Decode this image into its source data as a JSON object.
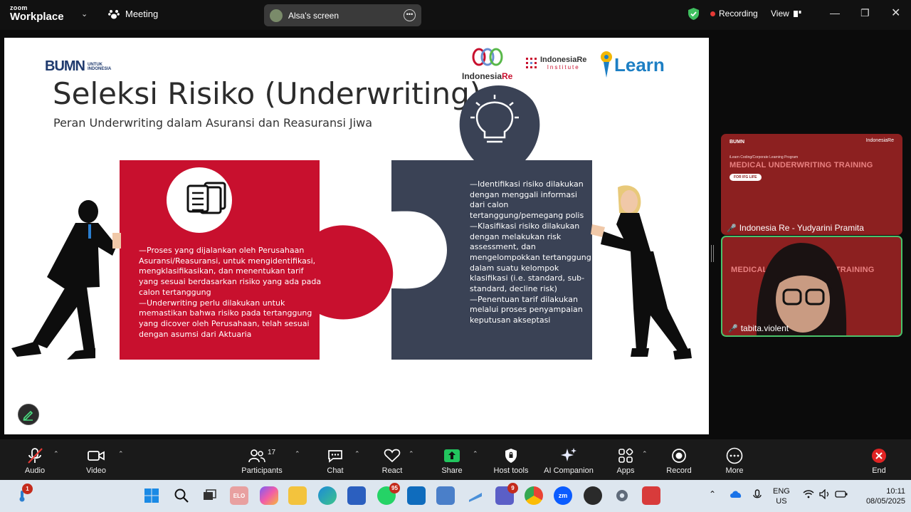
{
  "window": {
    "app_logo_line1": "zoom",
    "app_logo_line2": "Workplace",
    "meeting_label": "Meeting",
    "shared_screen_label": "Alsa's screen",
    "recording_label": "Recording",
    "view_label": "View"
  },
  "slide": {
    "bumn_logo_text": "BUMN",
    "bumn_logo_sub1": "UNTUK",
    "bumn_logo_sub2": "INDONESIA",
    "title": "Seleksi Risiko (Underwriting)",
    "subtitle": "Peran Underwriting dalam Asuransi dan Reasuransi Jiwa",
    "logo_indonesiare_a": "Indonesia",
    "logo_indonesiare_b": "Re",
    "logo_iri_line1": "IndonesiaRe",
    "logo_iri_line2": "Institute",
    "logo_ilearn": "Learn",
    "left_piece_text": [
      "—Proses yang dijalankan oleh Perusahaan",
      "Asuransi/Reasuransi, untuk mengidentifikasi,",
      "mengklasifikasikan, dan menentukan tarif",
      "yang sesuai berdasarkan risiko yang ada pada",
      "calon tertanggung",
      "—Underwriting perlu dilakukan untuk",
      "memastikan bahwa risiko pada tertanggung",
      "yang dicover oleh Perusahaan, telah sesuai",
      "dengan asumsi dari Aktuaria"
    ],
    "right_piece_text": [
      "—Identifikasi risiko dilakukan",
      "dengan menggali informasi",
      "dari calon",
      "tertanggung/pemegang polis",
      "—Klasifikasi risiko dilakukan",
      "dengan melakukan risk",
      "assessment, dan",
      "mengelompokkan tertanggung",
      "dalam suatu kelompok",
      "klasifikasi (i.e. standard, sub-",
      "standard, decline risk)",
      "—Penentuan tarif dilakukan",
      "melalui proses penyampaian",
      "keputusan akseptasi"
    ]
  },
  "tiles": [
    {
      "top_left": "BUMN",
      "top_right": "IndonesiaRe",
      "program_label": "iLearn Coding/Corporate Learning Program",
      "banner": "MEDICAL UNDERWRITING TRAINING",
      "pill": "FOR IFG LIFE",
      "name": "Indonesia Re - Yudyarini Pramita"
    },
    {
      "banner": "MEDICAL UNDERWRITING TRAINING",
      "name": "tabita.violent"
    }
  ],
  "toolbar": {
    "audio": "Audio",
    "video": "Video",
    "participants": "Participants",
    "participants_count": "17",
    "chat": "Chat",
    "react": "React",
    "share": "Share",
    "host_tools": "Host tools",
    "ai_companion": "AI Companion",
    "apps": "Apps",
    "record": "Record",
    "more": "More",
    "end": "End"
  },
  "taskbar": {
    "notif_badge": "1",
    "whatsapp_badge": "95",
    "teams_badge": "9",
    "lang_line1": "ENG",
    "lang_line2": "US",
    "time": "10:11",
    "date": "08/05/2025"
  },
  "colors": {
    "slide_red": "#c8102e",
    "slide_navy": "#3a4255",
    "tile_red": "#8c2020",
    "active_tile_border": "#4ac26b",
    "share_green": "#22c55e",
    "end_red": "#e02424"
  }
}
